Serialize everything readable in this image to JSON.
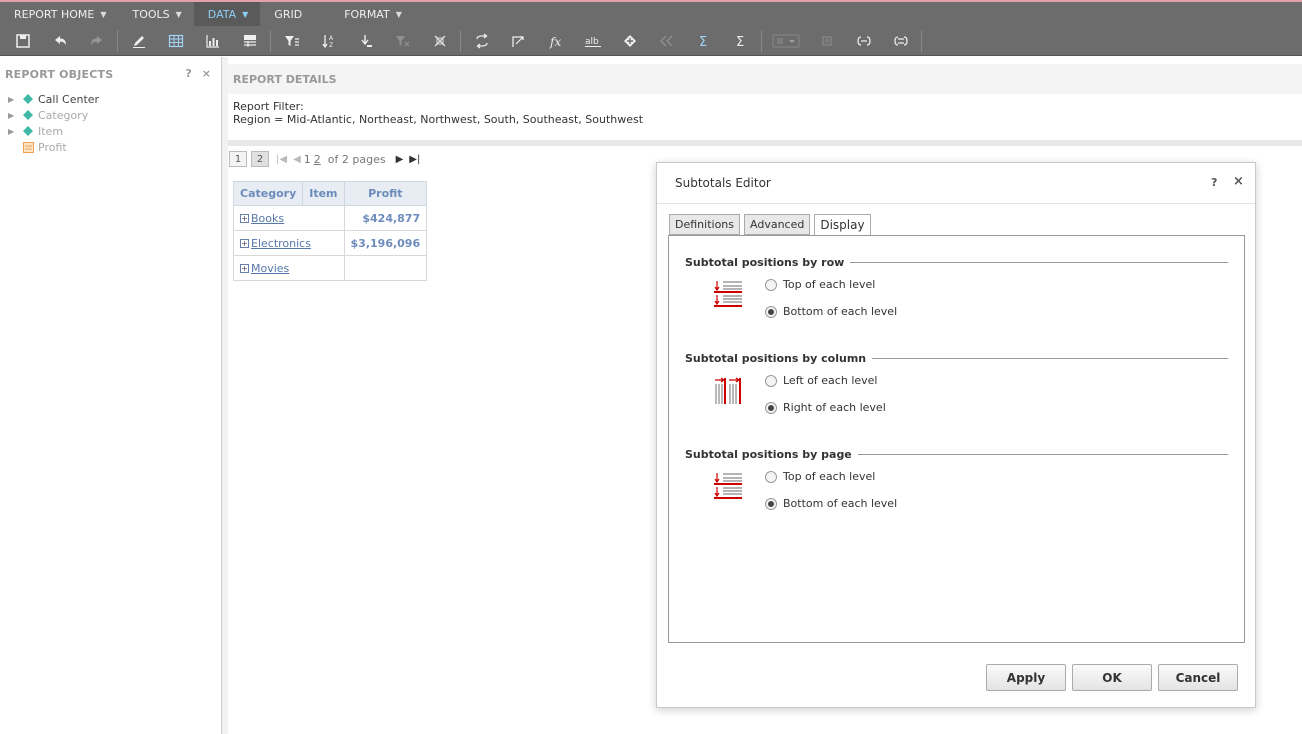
{
  "menubar": {
    "items": [
      {
        "label": "REPORT HOME"
      },
      {
        "label": "TOOLS"
      },
      {
        "label": "DATA"
      },
      {
        "label": "GRID"
      },
      {
        "label": "FORMAT"
      }
    ]
  },
  "toolbar": {
    "icons": [
      "save-icon",
      "undo-icon",
      "redo-icon",
      "edit-icon",
      "grid-view-icon",
      "graph-view-icon",
      "grid-graph-icon",
      "filter-icon",
      "sort-icon",
      "drill-icon",
      "clear-filter-icon",
      "remove-icon",
      "pivot-icon",
      "page-by-icon",
      "formula-icon",
      "rename-icon",
      "insert-icon",
      "back-icon",
      "subtotal-icon",
      "sum-icon",
      "merge-icon",
      "link-icon",
      "group-icon",
      "ungroup-icon"
    ]
  },
  "report_objects": {
    "title": "REPORT OBJECTS",
    "help": "?",
    "close": "×",
    "items": [
      {
        "label": "Call Center"
      },
      {
        "label": "Category"
      },
      {
        "label": "Item"
      },
      {
        "label": "Profit"
      }
    ]
  },
  "report_details": {
    "title": "REPORT DETAILS",
    "filter_label": "Report Filter:",
    "filter_value": "Region = Mid-Atlantic, Northeast, Northwest, South, Southeast, Southwest"
  },
  "pager": {
    "page1": "1",
    "page2": "2",
    "current": "1",
    "link": "2",
    "of_text": "of 2 pages"
  },
  "grid": {
    "headers": [
      "Category",
      "Item",
      "Profit"
    ],
    "rows": [
      {
        "category": "Books",
        "profit": "$424,877"
      },
      {
        "category": "Electronics",
        "profit": "$3,196,096"
      },
      {
        "category": "Movies",
        "profit": ""
      }
    ]
  },
  "dialog": {
    "title": "Subtotals Editor",
    "help": "?",
    "close": "×",
    "tabs": [
      "Definitions",
      "Advanced",
      "Display"
    ],
    "active_tab": "Display",
    "sections": [
      {
        "title": "Subtotal positions by row",
        "options": [
          "Top of each level",
          "Bottom of each level"
        ],
        "selected": 1
      },
      {
        "title": "Subtotal positions by column",
        "options": [
          "Left of each level",
          "Right of each level"
        ],
        "selected": 1
      },
      {
        "title": "Subtotal positions by page",
        "options": [
          "Top of each level",
          "Bottom of each level"
        ],
        "selected": 1
      }
    ],
    "buttons": {
      "apply": "Apply",
      "ok": "OK",
      "cancel": "Cancel"
    }
  },
  "colors": {
    "menubar": "#6c6c6c",
    "active_menu": "#8ccff7",
    "header_blue": "#6d8cbc",
    "subtotal_red": "#cc0000"
  }
}
